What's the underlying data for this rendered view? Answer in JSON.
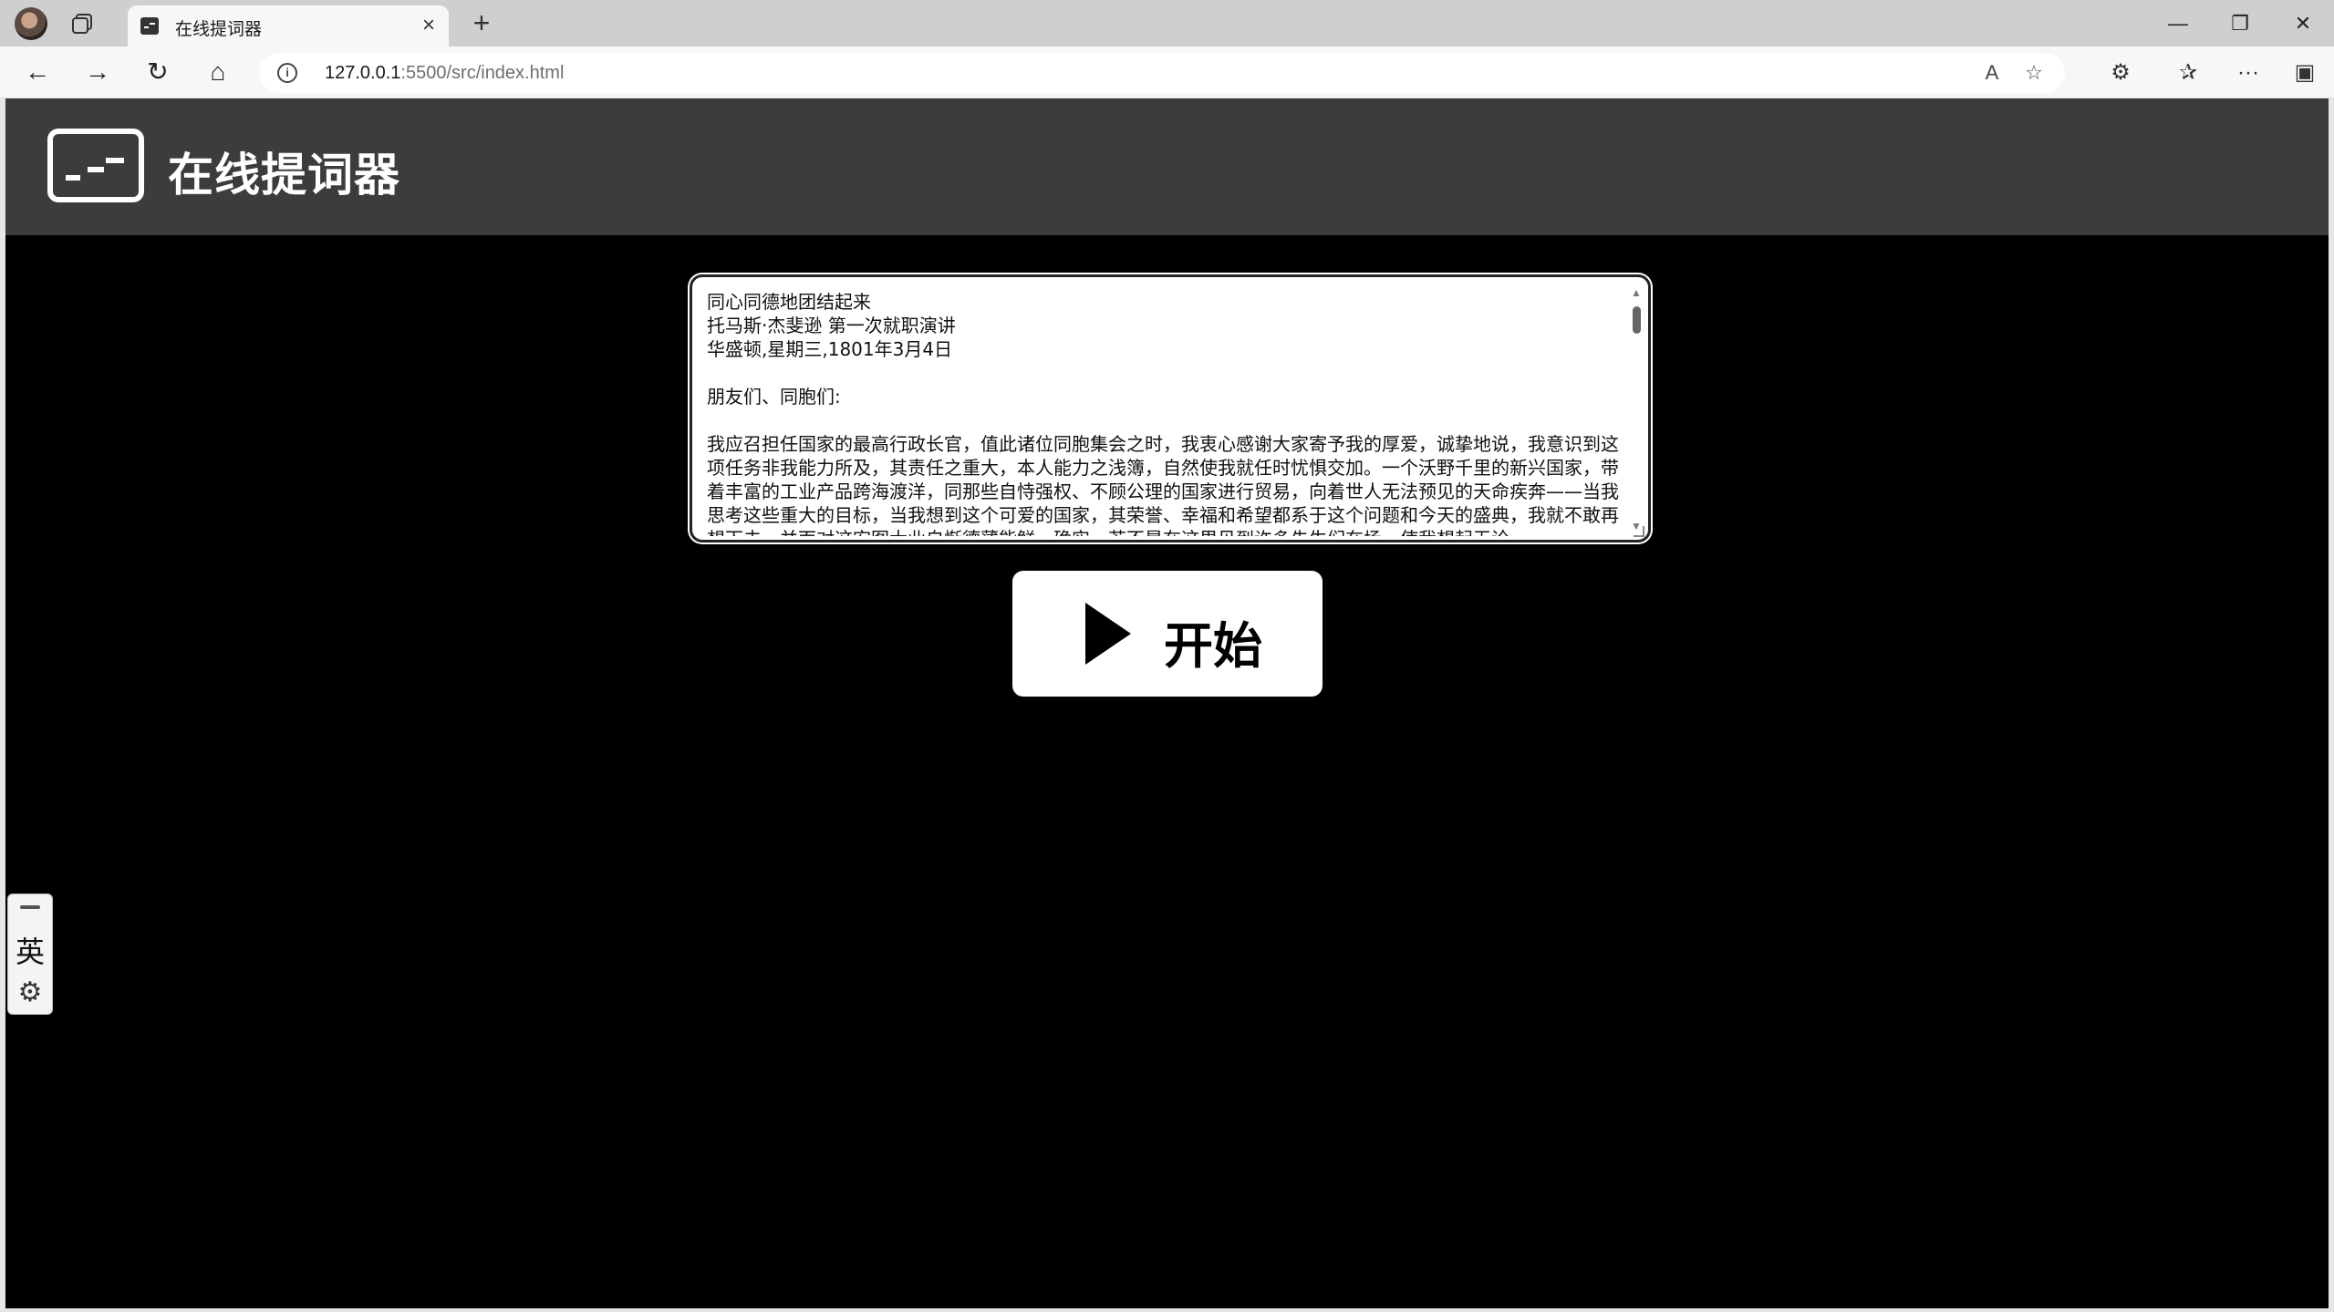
{
  "browser": {
    "tab_title": "在线提词器",
    "tab_close": "×",
    "new_tab": "+",
    "url_host": "127.0.0.1",
    "url_path": ":5500/src/index.html",
    "info_icon": "i",
    "read_aloud_icon": "A",
    "favorite_icon": "☆",
    "extensions_icon": "⚙",
    "favorites_icon": "✰",
    "more_icon": "···",
    "sidebar_icon": "▣",
    "back_icon": "←",
    "forward_icon": "→",
    "refresh_icon": "↻",
    "home_icon": "⌂",
    "minimize_icon": "—",
    "restore_icon": "❐",
    "close_icon": "✕"
  },
  "header": {
    "app_title": "在线提词器"
  },
  "editor": {
    "script_text": "同心同德地团结起来\n托马斯·杰斐逊 第一次就职演讲\n华盛顿,星期三,1801年3月4日\n\n朋友们、同胞们:\n\n我应召担任国家的最高行政长官，值此诸位同胞集会之时，我衷心感谢大家寄予我的厚爱，诚挚地说，我意识到这项任务非我能力所及，其责任之重大，本人能力之浅簿，自然使我就任时忧惧交加。一个沃野千里的新兴国家，带着丰富的工业产品跨海渡洋，同那些自恃强权、不顾公理的国家进行贸易，向着世人无法预见的天命疾奔——当我思考这些重大的目标，当我想到这个可爱的国家，其荣誉、幸福和希望都系于这个问题和今天的盛典，我就不敢再想下去，并面对这宏图大业自惭德薄能鲜。确实，若不是在这里见到许多先生们在场，使我想起无论"
  },
  "controls": {
    "start_label": "开始"
  },
  "ime": {
    "language": "英",
    "settings_icon": "⚙"
  },
  "colors": {
    "header_bg": "#3c3c3c",
    "page_bg": "#000000",
    "button_bg": "#ffffff"
  }
}
